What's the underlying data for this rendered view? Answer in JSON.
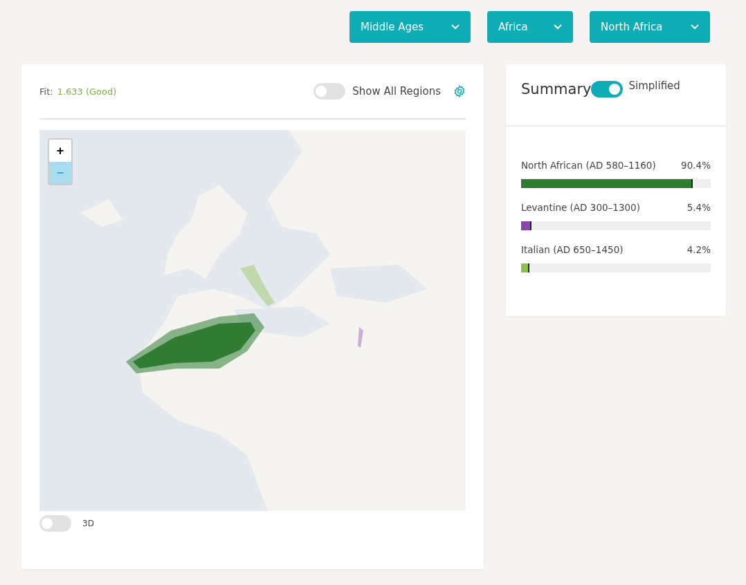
{
  "filters": [
    {
      "label": "Middle Ages"
    },
    {
      "label": "Africa"
    },
    {
      "label": "North Africa"
    }
  ],
  "fit": {
    "label": "Fit:",
    "value": "1.633 (Good)"
  },
  "show_all_regions": {
    "label": "Show All Regions",
    "on": false
  },
  "map": {
    "zoom_in": "+",
    "zoom_out": "−"
  },
  "toggle_3d": {
    "label": "3D",
    "on": false
  },
  "summary": {
    "title": "Summary",
    "simplified": {
      "label": "Simplified",
      "on": true
    },
    "items": [
      {
        "label": "North African (AD 580–1160)",
        "percent": "90.4%",
        "level": 0.904,
        "color": "#2e7d32"
      },
      {
        "label": "Levantine (AD 300–1300)",
        "percent": "5.4%",
        "level": 0.054,
        "color": "#8e44ad"
      },
      {
        "label": "Italian (AD 650–1450)",
        "percent": "4.2%",
        "level": 0.042,
        "color": "#8bc34a"
      }
    ]
  }
}
